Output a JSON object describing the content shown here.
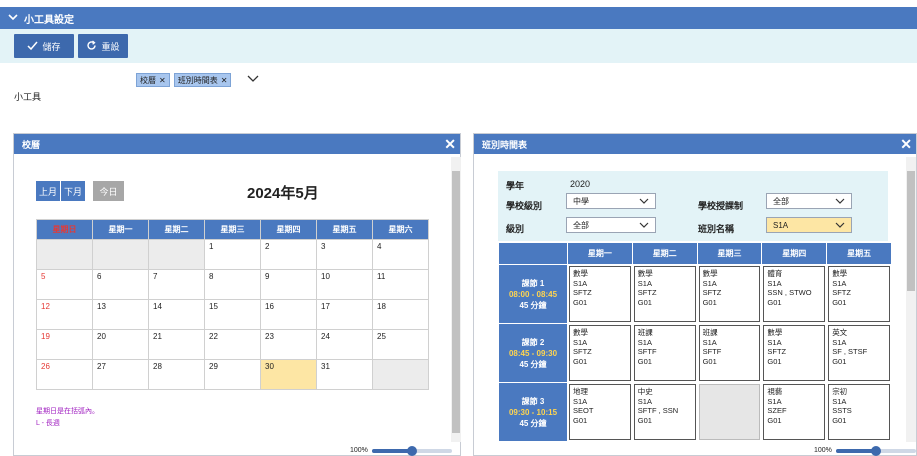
{
  "colors": {
    "header": "#4a79c0",
    "toolbar": "#e3f3f7",
    "today": "#fde6a4",
    "sunday": "#e53935",
    "note": "#a020c0"
  },
  "section_title": "小工具設定",
  "toolbar": {
    "save_label": "儲存",
    "reset_label": "重設"
  },
  "widget_field": {
    "label": "小工具",
    "chips": [
      "校曆",
      "班別時間表"
    ]
  },
  "calendar_panel": {
    "title": "校曆",
    "prev_label": "上月",
    "next_label": "下月",
    "today_label": "今日",
    "month_title": "2024年5月",
    "weekdays": [
      "星期日",
      "星期一",
      "星期二",
      "星期三",
      "星期四",
      "星期五",
      "星期六"
    ],
    "weeks": [
      [
        "",
        "",
        "",
        "1",
        "2",
        "3",
        "4"
      ],
      [
        "5",
        "6",
        "7",
        "8",
        "9",
        "10",
        "11"
      ],
      [
        "12",
        "13",
        "14",
        "15",
        "16",
        "17",
        "18"
      ],
      [
        "19",
        "20",
        "21",
        "22",
        "23",
        "24",
        "25"
      ],
      [
        "26",
        "27",
        "28",
        "29",
        "30",
        "31",
        ""
      ]
    ],
    "today_day": "30",
    "notes": [
      "星期日是在括弧內。",
      "L - 長週"
    ],
    "zoom": "100%",
    "zoom_level": 0.5
  },
  "timetable_panel": {
    "title": "班別時間表",
    "year_label": "學年",
    "year_value": "2020",
    "level_label": "學校級別",
    "level_value": "中學",
    "mode_label": "學校授課制",
    "mode_value": "全部",
    "grade_label": "級別",
    "grade_value": "全部",
    "class_label": "班別名稱",
    "class_value": "S1A",
    "days": [
      "星期一",
      "星期二",
      "星期三",
      "星期四",
      "星期五"
    ],
    "periods": [
      {
        "name": "課節 1",
        "time": "08:00 - 08:45",
        "duration": "45 分鐘",
        "lessons": [
          [
            "數學",
            "S1A",
            "SFTZ",
            "G01"
          ],
          [
            "數學",
            "S1A",
            "SFTZ",
            "G01"
          ],
          [
            "數學",
            "S1A",
            "SFTZ",
            "G01"
          ],
          [
            "體育",
            "S1A",
            "SSN , STWO",
            "G01"
          ],
          [
            "數學",
            "S1A",
            "SFTZ",
            "G01"
          ]
        ]
      },
      {
        "name": "課節 2",
        "time": "08:45 - 09:30",
        "duration": "45 分鐘",
        "lessons": [
          [
            "數學",
            "S1A",
            "SFTZ",
            "G01"
          ],
          [
            "班課",
            "S1A",
            "SFTF",
            "G01"
          ],
          [
            "班課",
            "S1A",
            "SFTF",
            "G01"
          ],
          [
            "數學",
            "S1A",
            "SFTZ",
            "G01"
          ],
          [
            "英文",
            "S1A",
            "SF , STSF",
            "G01"
          ]
        ]
      },
      {
        "name": "課節 3",
        "time": "09:30 - 10:15",
        "duration": "45 分鐘",
        "lessons": [
          [
            "地理",
            "S1A",
            "SEOT",
            "G01"
          ],
          [
            "中史",
            "S1A",
            "SFTF , SSN",
            "G01"
          ],
          [],
          [
            "視藝",
            "S1A",
            "SZEF",
            "G01"
          ],
          [
            "宗初",
            "S1A",
            "SSTS",
            "G01"
          ]
        ]
      }
    ],
    "zoom": "100%",
    "zoom_level": 0.5
  }
}
